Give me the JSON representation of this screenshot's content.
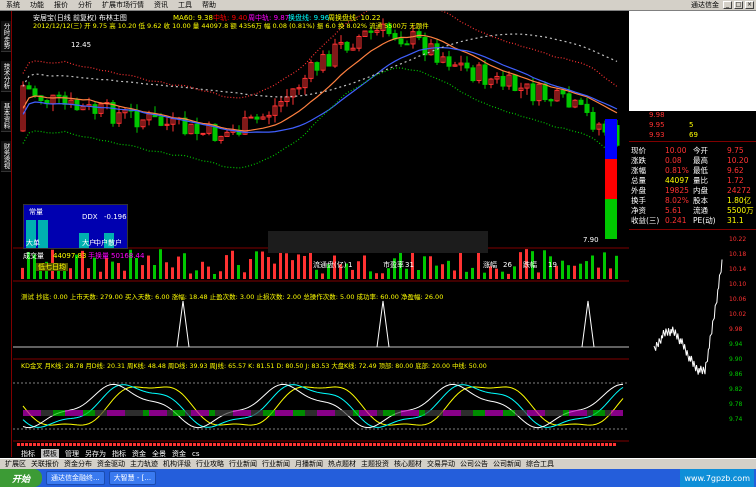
{
  "menubar": {
    "items": [
      "系统",
      "功能",
      "报价",
      "分析",
      "扩展市场行情",
      "资讯",
      "工具",
      "帮助"
    ],
    "brand": "通达信金"
  },
  "left_tabs": [
    "分时走势",
    "技术分析",
    "基本资料",
    "财务透视"
  ],
  "main": {
    "title": "安居宝(日线 前复权) 布林主图",
    "ma_labels": {
      "ma60": "MA60: 9.38",
      "zhongxian": "中轨: 9.40",
      "zhoucheng": "周中轨: 9.87",
      "huanxian": "换盘线: 9.96",
      "zhouhuan": "周换盘线: 10.22"
    },
    "ohlc_line": "2012/12/12(三) 开 9.75 高 10.20 低 9.62 收 10.00 量 44097.8 额 4356万 幅 0.08 (0.81%) 振 6.0 换 8.02% 流通 5500万 无题件",
    "price_high": "12.45",
    "price_low": "7.90",
    "side_labels": [
      "常量",
      "DDX",
      "-0.196",
      "大单",
      "单量",
      "大户",
      "中户",
      "散户"
    ],
    "vol_header": {
      "a": "成交量",
      "b": "44097.83",
      "c": "手换量",
      "d": "50168.44"
    },
    "vol_sub": "低七日均",
    "market_info": {
      "label1": "流通盘(亿)",
      "v1": "1",
      "label2": "市盈率",
      "v2": "31",
      "label3": "涨幅",
      "v3": "26",
      "label4": "跌幅",
      "v4": "19"
    },
    "ind1": "测试  抄底: 0.00  上市天数: 279.00   买入天数: 6.00  涨幅: 18.48   止盈次数: 3.00  止损次数: 2.00  总操作次数: 5.00  成功率: 60.00  净盈幅: 26.00",
    "ind2": "KD金叉  月K线: 28.78  月D线: 20.31  周K线: 48.48  周D线: 39.93  周J线: 65.57     K: 81.51   D: 80.50   J: 83.53   大盘K线: 72.49   顶部: 80.00  底部: 20.00  中线: 50.00"
  },
  "quote": {
    "rows": [
      {
        "l": "现价",
        "v": "10.00",
        "l2": "今开",
        "v2": "9.75"
      },
      {
        "l": "涨跌",
        "v": "0.08",
        "l2": "最高",
        "v2": "10.20"
      },
      {
        "l": "涨幅",
        "v": "0.81%",
        "l2": "最低",
        "v2": "9.62"
      },
      {
        "l": "总量",
        "v": "44097",
        "l2": "量比",
        "v2": "1.72"
      },
      {
        "l": "外盘",
        "v": "19825",
        "l2": "内盘",
        "v2": "24272"
      },
      {
        "l": "换手",
        "v": "8.02%",
        "l2": "股本",
        "v2": "1.80亿"
      },
      {
        "l": "净资",
        "v": "5.61",
        "l2": "流通",
        "v2": "5500万"
      },
      {
        "l": "收益(三)",
        "v": "0.241",
        "l2": "PE(动)",
        "v2": "31.1"
      }
    ],
    "orderbook": [
      "9.98",
      "9.95",
      "9.93",
      "5",
      "69"
    ],
    "axis": [
      "10.22",
      "10.18",
      "10.14",
      "10.10",
      "10.06",
      "10.02",
      "9.98",
      "9.94",
      "9.90",
      "9.86",
      "9.82",
      "9.78",
      "9.74"
    ]
  },
  "tabs": [
    "指标",
    "模板",
    "管理",
    "另存为",
    "指标",
    "资金",
    "全景",
    "资金",
    "cs"
  ],
  "quickbar": [
    "扩展区",
    "关联报价",
    "资金分布",
    "资金驱动",
    "主力轨迹",
    "机构评级",
    "行业攻略",
    "行业新闻",
    "行业新闻",
    "月播新闻",
    "热点题材",
    "主题投资",
    "核心题材",
    "交易异动",
    "公司公告",
    "公司新闻",
    "综合工具"
  ],
  "taskbar": {
    "start": "开始",
    "tasks": [
      "通达信金融终...",
      "大智慧 - [..."
    ],
    "tray": "www.7gpzb.com"
  },
  "colors": {
    "up": "#ff3232",
    "down": "#00ffff",
    "green": "#00c800",
    "white": "#ffffff",
    "yellow": "#ffff00",
    "purple": "#c000c0"
  }
}
